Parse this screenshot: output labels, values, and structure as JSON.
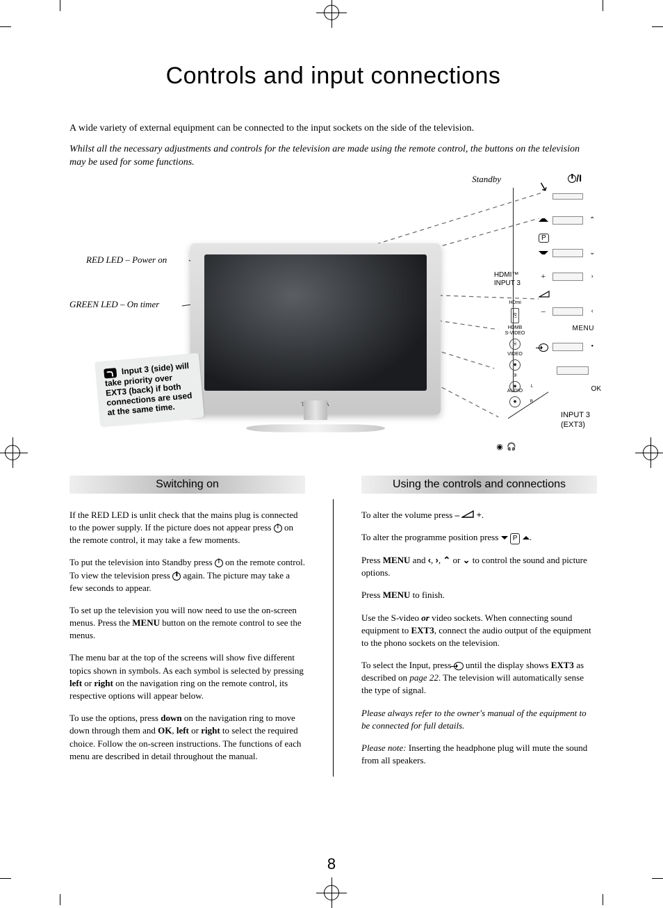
{
  "title": "Controls and input connections",
  "intro1": "A wide variety of external equipment can be connected to the input sockets on the side of the television.",
  "intro2": "Whilst all the necessary adjustments and controls for the television are made using the remote control, the buttons on the television may be used for some functions.",
  "diagram": {
    "red_led": "RED LED – Power on",
    "green_led": "GREEN LED – On timer",
    "standby": "Standby",
    "power_sym": "⏻/I",
    "hdmi_label": "HDMI™",
    "input3_top": "INPUT 3",
    "hdmi_small": "HDMI",
    "menu": "MENU",
    "ok": "OK",
    "input3_ext3_a": "INPUT 3",
    "input3_ext3_b": "(EXT3)",
    "p_badge": "P",
    "note_text": "Input 3 (side) will take priority over EXT3 (back) if both connections are used at the same time.",
    "ports": {
      "hdmb": "HDMB",
      "svideo": "S-VIDEO",
      "video": "VIDEO",
      "three": "③",
      "audio": "AUDIO",
      "l": "L",
      "r": "R"
    }
  },
  "section_left": {
    "heading": "Switching on",
    "p1a": "If the RED LED is unlit check that the mains plug is connected to the power supply. If the picture does not appear press ",
    "p1b": " on the remote control, it may take a few moments.",
    "p2a": "To put the television into Standby press ",
    "p2b": " on the remote control. To view the television press ",
    "p2c": " again. The picture may take a few seconds to appear.",
    "p3a": "To set up the television you will now need to use the on-screen menus. Press the ",
    "p3_menu": "MENU",
    "p3b": " button on the remote control to see the menus.",
    "p4a": "The menu bar at the top of the screens will show five different topics shown in symbols. As each symbol is selected by pressing ",
    "p4_left": "left",
    "p4_or1": " or ",
    "p4_right": "right",
    "p4b": " on the navigation ring on the remote control, its respective options will appear below.",
    "p5a": "To use the options, press ",
    "p5_down": "down",
    "p5b": " on the navigation ring to move down through them and ",
    "p5_ok": "OK",
    "p5_comma": ", ",
    "p5_left": "left",
    "p5_or": " or ",
    "p5_right": "right",
    "p5c": " to select the required choice. Follow the on-screen instructions. The functions of each menu are described in detail throughout the manual."
  },
  "section_right": {
    "heading": "Using the controls and connections",
    "p1a": "To alter the volume press ",
    "p1_minus": "–",
    "p1_plus": " +",
    "p1b": ".",
    "p2a": "To alter the programme position press ",
    "p2b": ".",
    "p3a": "Press ",
    "p3_menu": "MENU",
    "p3_and": " and ",
    "p3b": " to control the sound and picture options.",
    "p4a": "Press ",
    "p4_menu": "MENU",
    "p4b": " to finish.",
    "p5a": "Use the S-video ",
    "p5_or": "or",
    "p5b": " video sockets. When connecting sound equipment to ",
    "p5_ext3": "EXT3",
    "p5c": ", connect the audio output of the equipment to the phono sockets on the television.",
    "p6a": "To select the Input, press ",
    "p6b": " until the display shows ",
    "p6_ext3": "EXT3",
    "p6c": " as described on ",
    "p6_page": "page 22",
    "p6d": ". The television will automatically sense the type of signal.",
    "p7": "Please always refer to the owner's manual of the equipment to be connected for full details.",
    "p8a": "Please note:",
    "p8b": " Inserting the headphone plug will mute the sound from all speakers."
  },
  "page_number": "8"
}
